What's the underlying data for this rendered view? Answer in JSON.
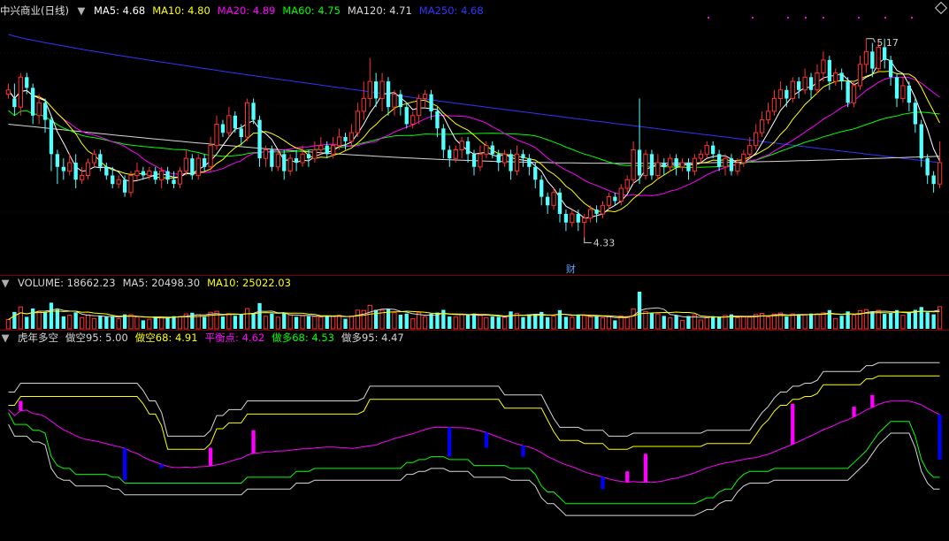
{
  "price_panel": {
    "title": "中兴商业(日线)",
    "indicators": [
      {
        "label": "MA5: 4.68",
        "color": "#ffffff"
      },
      {
        "label": "MA10: 4.80",
        "color": "#ffff00"
      },
      {
        "label": "MA20: 4.89",
        "color": "#ff00ff"
      },
      {
        "label": "MA60: 4.75",
        "color": "#00ff00"
      },
      {
        "label": "MA120: 4.71",
        "color": "#d8d8d8"
      },
      {
        "label": "MA250: 4.68",
        "color": "#3333ff"
      }
    ],
    "high_label": "5.17",
    "low_label": "4.33",
    "event_label": "财"
  },
  "volume_panel": {
    "indicators": [
      {
        "label": "VOLUME: 18662.23",
        "color": "#d8d8d8"
      },
      {
        "label": "MA5: 20498.30",
        "color": "#d8d8d8"
      },
      {
        "label": "MA10: 25022.03",
        "color": "#ffff00"
      }
    ]
  },
  "indicator_panel": {
    "title": "虎年多空",
    "indicators": [
      {
        "label": "做空95: 5.00",
        "color": "#d8d8d8"
      },
      {
        "label": "做空68: 4.91",
        "color": "#ffff00"
      },
      {
        "label": "平衡点: 4.62",
        "color": "#ff00ff"
      },
      {
        "label": "做多68: 4.53",
        "color": "#00ff00"
      },
      {
        "label": "做多95: 4.47",
        "color": "#d8d8d8"
      }
    ]
  },
  "colors": {
    "up": "#ff3030",
    "down": "#54ffff",
    "grid": "#800000",
    "ma5": "#ffffff",
    "ma10": "#ffff00",
    "ma20": "#ff00ff",
    "ma60": "#00ff00",
    "ma120": "#d8d8d8",
    "ma250": "#3333ff",
    "sig_pos": "#ff00ff",
    "sig_neg": "#0000ff"
  },
  "chart_data": {
    "type": "candlestick",
    "price_range": [
      4.2,
      5.35
    ],
    "ma_current": {
      "ma5": 4.68,
      "ma10": 4.8,
      "ma20": 4.89,
      "ma60": 4.75,
      "ma120": 4.71,
      "ma250": 4.68
    },
    "candles_ohlc": [
      [
        5.0,
        5.02,
        4.98,
        5.05
      ],
      [
        4.98,
        4.94,
        4.9,
        5.05
      ],
      [
        4.94,
        5.08,
        4.9,
        5.1
      ],
      [
        5.08,
        5.03,
        5.0,
        5.1
      ],
      [
        5.03,
        4.9,
        4.86,
        5.05
      ],
      [
        4.9,
        4.96,
        4.86,
        5.0
      ],
      [
        4.96,
        4.88,
        4.82,
        4.98
      ],
      [
        4.88,
        4.72,
        4.64,
        4.9
      ],
      [
        4.72,
        4.66,
        4.58,
        4.74
      ],
      [
        4.66,
        4.64,
        4.6,
        4.7
      ],
      [
        4.64,
        4.68,
        4.62,
        4.72
      ],
      [
        4.68,
        4.6,
        4.56,
        4.72
      ],
      [
        4.6,
        4.62,
        4.58,
        4.66
      ],
      [
        4.62,
        4.68,
        4.6,
        4.7
      ],
      [
        4.68,
        4.72,
        4.66,
        4.74
      ],
      [
        4.72,
        4.66,
        4.64,
        4.74
      ],
      [
        4.66,
        4.62,
        4.6,
        4.68
      ],
      [
        4.62,
        4.58,
        4.56,
        4.66
      ],
      [
        4.58,
        4.6,
        4.56,
        4.62
      ],
      [
        4.6,
        4.54,
        4.52,
        4.62
      ],
      [
        4.54,
        4.62,
        4.52,
        4.64
      ],
      [
        4.62,
        4.64,
        4.6,
        4.68
      ],
      [
        4.64,
        4.62,
        4.6,
        4.66
      ],
      [
        4.62,
        4.64,
        4.6,
        4.66
      ],
      [
        4.64,
        4.6,
        4.58,
        4.66
      ],
      [
        4.6,
        4.64,
        4.56,
        4.66
      ],
      [
        4.64,
        4.6,
        4.58,
        4.66
      ],
      [
        4.6,
        4.58,
        4.56,
        4.64
      ],
      [
        4.58,
        4.64,
        4.56,
        4.66
      ],
      [
        4.64,
        4.7,
        4.62,
        4.74
      ],
      [
        4.7,
        4.62,
        4.6,
        4.72
      ],
      [
        4.62,
        4.7,
        4.6,
        4.72
      ],
      [
        4.7,
        4.66,
        4.64,
        4.72
      ],
      [
        4.66,
        4.76,
        4.64,
        4.8
      ],
      [
        4.76,
        4.86,
        4.74,
        4.9
      ],
      [
        4.86,
        4.82,
        4.8,
        4.88
      ],
      [
        4.82,
        4.9,
        4.8,
        4.94
      ],
      [
        4.9,
        4.84,
        4.82,
        4.92
      ],
      [
        4.84,
        4.8,
        4.76,
        4.86
      ],
      [
        4.8,
        4.96,
        4.78,
        4.98
      ],
      [
        4.96,
        4.88,
        4.86,
        4.98
      ],
      [
        4.88,
        4.7,
        4.66,
        4.9
      ],
      [
        4.7,
        4.74,
        4.66,
        4.76
      ],
      [
        4.74,
        4.66,
        4.64,
        4.76
      ],
      [
        4.66,
        4.72,
        4.64,
        4.74
      ],
      [
        4.72,
        4.64,
        4.6,
        4.74
      ],
      [
        4.64,
        4.7,
        4.62,
        4.72
      ],
      [
        4.7,
        4.68,
        4.64,
        4.74
      ],
      [
        4.68,
        4.72,
        4.66,
        4.76
      ],
      [
        4.72,
        4.7,
        4.66,
        4.74
      ],
      [
        4.7,
        4.74,
        4.68,
        4.78
      ],
      [
        4.74,
        4.76,
        4.72,
        4.8
      ],
      [
        4.76,
        4.72,
        4.7,
        4.78
      ],
      [
        4.72,
        4.76,
        4.7,
        4.8
      ],
      [
        4.76,
        4.8,
        4.74,
        4.84
      ],
      [
        4.8,
        4.78,
        4.74,
        4.82
      ],
      [
        4.78,
        4.82,
        4.76,
        4.86
      ],
      [
        4.82,
        4.92,
        4.8,
        4.96
      ],
      [
        4.92,
        4.98,
        4.88,
        5.06
      ],
      [
        4.98,
        5.06,
        4.94,
        5.17
      ],
      [
        5.06,
        4.98,
        4.94,
        5.1
      ],
      [
        4.98,
        5.06,
        4.92,
        5.1
      ],
      [
        5.06,
        4.94,
        4.9,
        5.08
      ],
      [
        4.94,
        5.0,
        4.9,
        5.02
      ],
      [
        5.0,
        4.94,
        4.9,
        5.02
      ],
      [
        4.94,
        4.86,
        4.84,
        4.96
      ],
      [
        4.86,
        4.9,
        4.84,
        4.92
      ],
      [
        4.9,
        4.98,
        4.86,
        5.0
      ],
      [
        4.98,
        5.0,
        4.94,
        5.02
      ],
      [
        5.0,
        4.92,
        4.88,
        5.02
      ],
      [
        4.92,
        4.84,
        4.8,
        4.94
      ],
      [
        4.84,
        4.74,
        4.7,
        4.86
      ],
      [
        4.74,
        4.7,
        4.66,
        4.76
      ],
      [
        4.7,
        4.74,
        4.68,
        4.76
      ],
      [
        4.74,
        4.78,
        4.7,
        4.8
      ],
      [
        4.78,
        4.72,
        4.68,
        4.8
      ],
      [
        4.72,
        4.66,
        4.62,
        4.74
      ],
      [
        4.66,
        4.72,
        4.64,
        4.76
      ],
      [
        4.72,
        4.76,
        4.7,
        4.78
      ],
      [
        4.76,
        4.72,
        4.7,
        4.78
      ],
      [
        4.72,
        4.68,
        4.64,
        4.74
      ],
      [
        4.68,
        4.72,
        4.66,
        4.74
      ],
      [
        4.72,
        4.64,
        4.6,
        4.74
      ],
      [
        4.64,
        4.72,
        4.62,
        4.76
      ],
      [
        4.72,
        4.7,
        4.66,
        4.74
      ],
      [
        4.7,
        4.66,
        4.62,
        4.72
      ],
      [
        4.66,
        4.6,
        4.56,
        4.68
      ],
      [
        4.6,
        4.52,
        4.48,
        4.62
      ],
      [
        4.52,
        4.48,
        4.44,
        4.54
      ],
      [
        4.48,
        4.54,
        4.46,
        4.56
      ],
      [
        4.54,
        4.44,
        4.4,
        4.56
      ],
      [
        4.44,
        4.4,
        4.36,
        4.46
      ],
      [
        4.4,
        4.44,
        4.38,
        4.46
      ],
      [
        4.44,
        4.4,
        4.36,
        4.46
      ],
      [
        4.4,
        4.42,
        4.33,
        4.44
      ],
      [
        4.42,
        4.46,
        4.4,
        4.48
      ],
      [
        4.46,
        4.44,
        4.4,
        4.48
      ],
      [
        4.44,
        4.48,
        4.42,
        4.5
      ],
      [
        4.48,
        4.52,
        4.46,
        4.54
      ],
      [
        4.52,
        4.5,
        4.48,
        4.54
      ],
      [
        4.5,
        4.56,
        4.48,
        4.58
      ],
      [
        4.56,
        4.6,
        4.54,
        4.62
      ],
      [
        4.6,
        4.74,
        4.58,
        4.78
      ],
      [
        4.74,
        4.62,
        4.58,
        4.98
      ],
      [
        4.62,
        4.72,
        4.6,
        4.74
      ],
      [
        4.72,
        4.62,
        4.6,
        4.74
      ],
      [
        4.62,
        4.68,
        4.6,
        4.72
      ],
      [
        4.68,
        4.66,
        4.62,
        4.7
      ],
      [
        4.66,
        4.7,
        4.64,
        4.72
      ],
      [
        4.7,
        4.66,
        4.62,
        4.72
      ],
      [
        4.66,
        4.68,
        4.64,
        4.7
      ],
      [
        4.68,
        4.64,
        4.6,
        4.7
      ],
      [
        4.64,
        4.7,
        4.62,
        4.72
      ],
      [
        4.7,
        4.72,
        4.68,
        4.74
      ],
      [
        4.72,
        4.76,
        4.7,
        4.78
      ],
      [
        4.76,
        4.72,
        4.7,
        4.78
      ],
      [
        4.72,
        4.66,
        4.64,
        4.74
      ],
      [
        4.66,
        4.7,
        4.62,
        4.72
      ],
      [
        4.7,
        4.64,
        4.62,
        4.72
      ],
      [
        4.64,
        4.68,
        4.62,
        4.7
      ],
      [
        4.68,
        4.72,
        4.66,
        4.74
      ],
      [
        4.72,
        4.76,
        4.7,
        4.8
      ],
      [
        4.76,
        4.82,
        4.74,
        4.86
      ],
      [
        4.82,
        4.88,
        4.8,
        4.92
      ],
      [
        4.88,
        4.92,
        4.86,
        4.96
      ],
      [
        4.92,
        4.98,
        4.9,
        5.02
      ],
      [
        4.98,
        5.02,
        4.94,
        5.06
      ],
      [
        5.02,
        4.98,
        4.94,
        5.04
      ],
      [
        4.98,
        5.06,
        4.96,
        5.08
      ],
      [
        5.06,
        5.02,
        4.98,
        5.08
      ],
      [
        5.02,
        5.08,
        5.0,
        5.12
      ],
      [
        5.08,
        5.02,
        4.98,
        5.1
      ],
      [
        5.02,
        5.1,
        5.0,
        5.14
      ],
      [
        5.1,
        5.16,
        5.06,
        5.2
      ],
      [
        5.16,
        5.06,
        5.02,
        5.18
      ],
      [
        5.06,
        5.1,
        5.04,
        5.12
      ],
      [
        5.1,
        5.06,
        5.02,
        5.12
      ],
      [
        5.06,
        4.96,
        4.94,
        5.08
      ],
      [
        4.96,
        5.04,
        4.94,
        5.06
      ],
      [
        5.04,
        5.14,
        5.02,
        5.18
      ],
      [
        5.14,
        5.2,
        5.1,
        5.26
      ],
      [
        5.2,
        5.12,
        5.08,
        5.24
      ],
      [
        5.12,
        5.22,
        5.1,
        5.26
      ],
      [
        5.22,
        5.16,
        5.12,
        5.26
      ],
      [
        5.16,
        5.08,
        5.04,
        5.18
      ],
      [
        5.08,
        4.98,
        4.94,
        5.1
      ],
      [
        4.98,
        5.04,
        4.96,
        5.08
      ],
      [
        5.04,
        4.96,
        4.92,
        5.06
      ],
      [
        4.96,
        4.86,
        4.82,
        4.98
      ],
      [
        4.86,
        4.7,
        4.66,
        4.88
      ],
      [
        4.7,
        4.62,
        4.58,
        4.72
      ],
      [
        4.62,
        4.58,
        4.54,
        4.64
      ],
      [
        4.58,
        4.68,
        4.56,
        4.78
      ]
    ]
  }
}
